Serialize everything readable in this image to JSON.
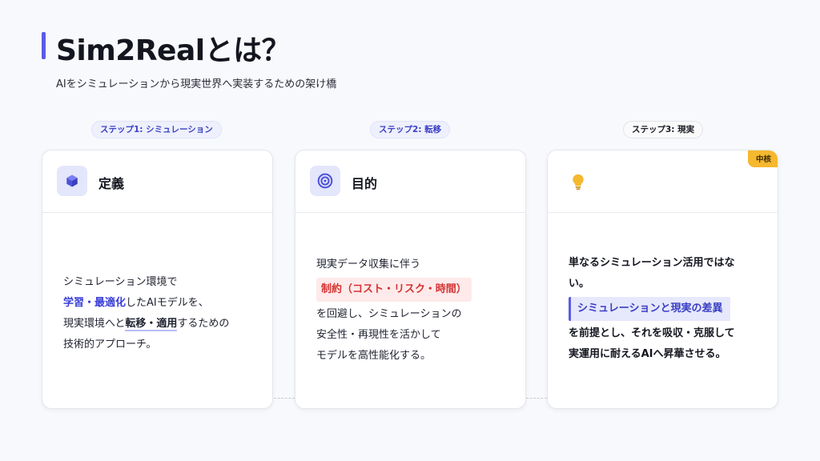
{
  "header": {
    "title": "Sim2Realとは？",
    "subtitle": "AIをシミュレーションから現実世界へ実装するための架け橋"
  },
  "steps": [
    {
      "pill": "ステップ1: シミュレーション"
    },
    {
      "pill": "ステップ2: 転移"
    },
    {
      "pill": "ステップ3: 現実"
    }
  ],
  "cards": [
    {
      "icon": "cube-icon",
      "title": "定義",
      "line1": "シミュレーション環境で",
      "line2_hl": "学習・最適化",
      "line2_rest": "したAIモデルを、",
      "line3_pre": "現実環境へと",
      "line3_hl": "転移・適用",
      "line3_rest": "するための",
      "line4": "技術的アプローチ。"
    },
    {
      "icon": "target-icon",
      "title": "目的",
      "line1": "現実データ収集に伴う",
      "highlight": "制約（コスト・リスク・時間）",
      "line2": "を回避し、シミュレーションの",
      "line3": "安全性・再現性を活かして",
      "line4": "モデルを高性能化する。"
    },
    {
      "icon": "lightbulb-icon",
      "title": "",
      "badge": "中核",
      "line1": "単なるシミュレーション活用ではな",
      "line2": "い。",
      "highlight": "シミュレーションと現実の差異",
      "line3": "を前提とし、それを吸収・克服して",
      "line4": "実運用に耐えるAIへ昇華させる。"
    }
  ],
  "colors": {
    "accent": "#5b5be6",
    "highlight_blue": "#3a3fd6",
    "highlight_red": "#d43333",
    "badge": "#f5b82e"
  }
}
